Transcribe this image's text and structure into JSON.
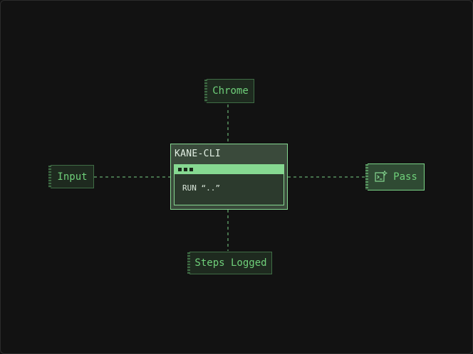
{
  "diagram": {
    "center": {
      "title": "KANE-CLI",
      "terminal_command": "RUN “..”"
    },
    "nodes": {
      "top": "Chrome",
      "left": "Input",
      "right": "Pass",
      "bottom": "Steps Logged"
    },
    "icons": {
      "pass": "terminal-sparkle-icon"
    },
    "colors": {
      "background": "#121212",
      "node_fill": "#1e2a1f",
      "node_border": "#3f6d45",
      "accent": "#86d891",
      "text": "#6fd07a",
      "connector": "#7ad386"
    }
  }
}
